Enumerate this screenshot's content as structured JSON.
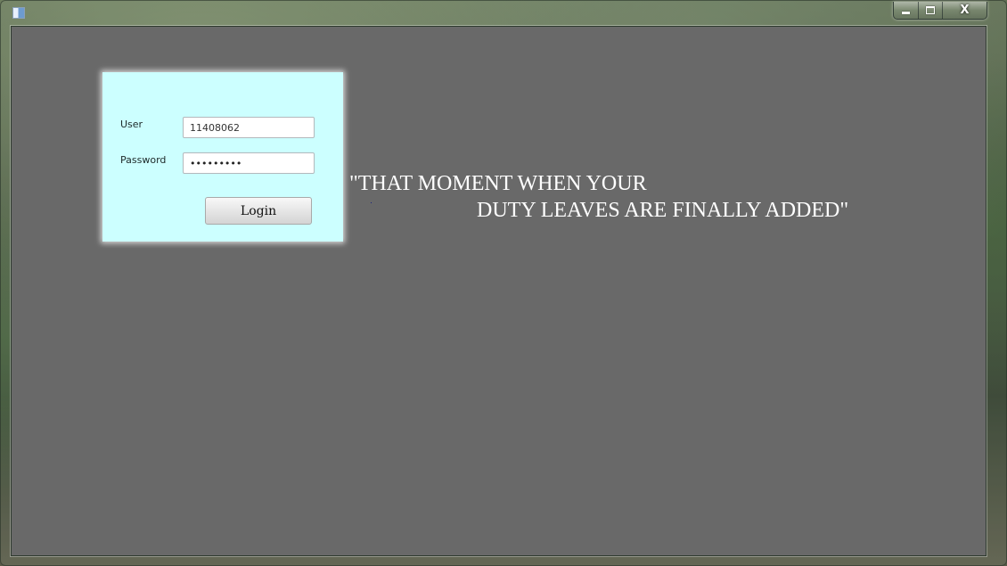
{
  "login": {
    "user_label": "User",
    "user_value": "11408062",
    "password_label": "Password",
    "password_value": "•••••••••",
    "login_label": "Login"
  },
  "quote": {
    "line1": "\"THAT MOMENT WHEN YOUR",
    "line2": "DUTY LEAVES ARE FINALLY ADDED\""
  },
  "titlebar": {
    "close_glyph": "X"
  },
  "colors": {
    "background": "#696969",
    "login_panel": "#ccffff",
    "quote_text": "#ffffff"
  }
}
